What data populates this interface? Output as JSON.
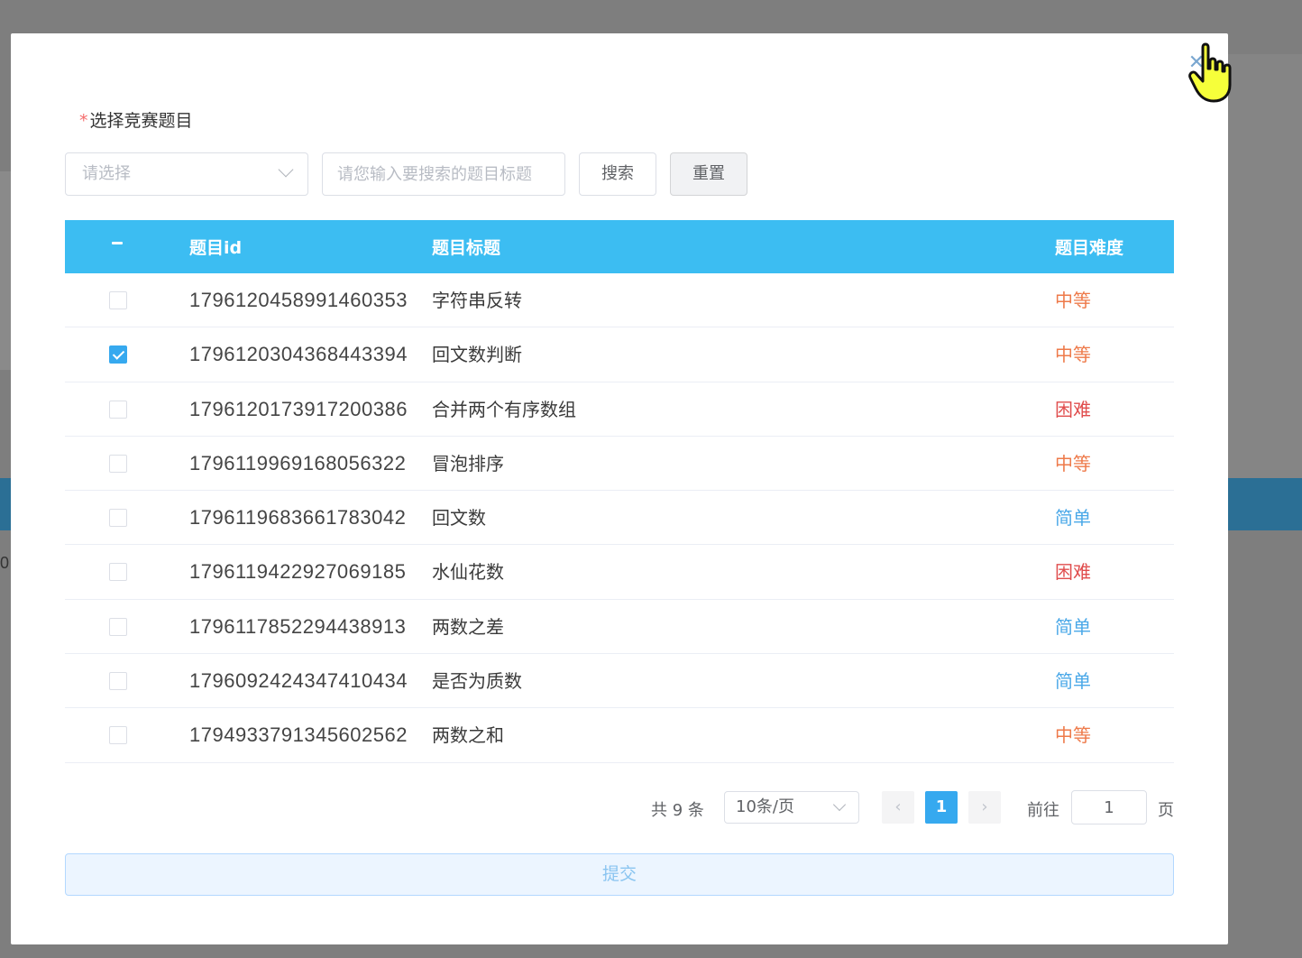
{
  "dialog": {
    "close_icon": "close-icon",
    "form_label": "选择竞赛题目",
    "required_mark": "*"
  },
  "filters": {
    "difficulty_placeholder": "请选择",
    "search_placeholder": "请您输入要搜索的题目标题",
    "search_label": "搜索",
    "reset_label": "重置"
  },
  "table": {
    "headers": {
      "select": "−",
      "id": "题目id",
      "title": "题目标题",
      "difficulty": "题目难度"
    },
    "rows": [
      {
        "id": "1796120458991460353",
        "title": "字符串反转",
        "difficulty": "中等",
        "checked": false
      },
      {
        "id": "1796120304368443394",
        "title": "回文数判断",
        "difficulty": "中等",
        "checked": true
      },
      {
        "id": "1796120173917200386",
        "title": "合并两个有序数组",
        "difficulty": "困难",
        "checked": false
      },
      {
        "id": "1796119969168056322",
        "title": "冒泡排序",
        "difficulty": "中等",
        "checked": false
      },
      {
        "id": "1796119683661783042",
        "title": "回文数",
        "difficulty": "简单",
        "checked": false
      },
      {
        "id": "1796119422927069185",
        "title": "水仙花数",
        "difficulty": "困难",
        "checked": false
      },
      {
        "id": "1796117852294438913",
        "title": "两数之差",
        "difficulty": "简单",
        "checked": false
      },
      {
        "id": "1796092424347410434",
        "title": "是否为质数",
        "difficulty": "简单",
        "checked": false
      },
      {
        "id": "1794933791345602562",
        "title": "两数之和",
        "difficulty": "中等",
        "checked": false
      }
    ]
  },
  "difficulty_colors": {
    "简单": "#4aa8e8",
    "中等": "#ee7a4a",
    "困难": "#e04d4d"
  },
  "pagination": {
    "total": "共 9 条",
    "page_size": "10条/页",
    "prev_icon": "‹",
    "next_icon": "›",
    "current_page": "1",
    "goto_label": "前往",
    "goto_value": "1",
    "page_unit": "页"
  },
  "submit_label": "提交",
  "background": {
    "left_text": "0"
  }
}
